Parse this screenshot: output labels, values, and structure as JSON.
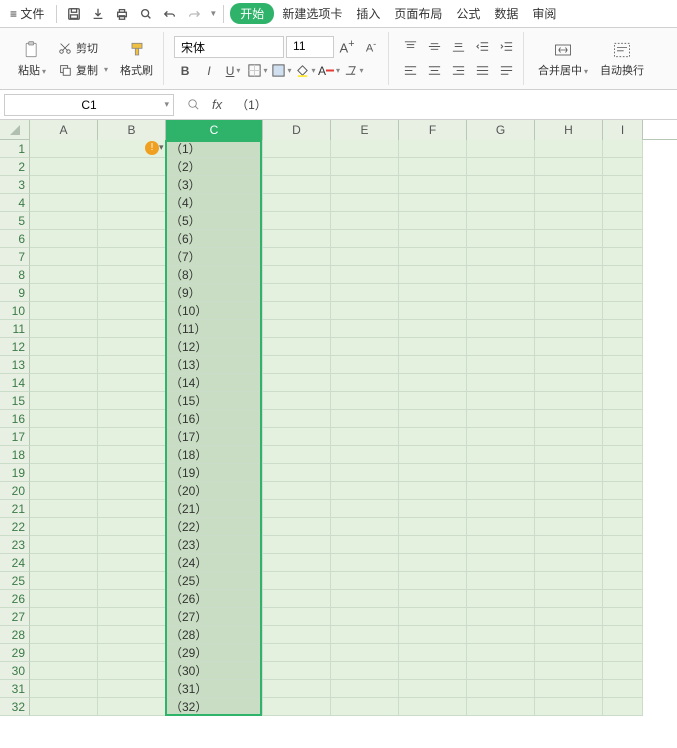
{
  "menu": {
    "file": "文件",
    "start": "开始",
    "newtab": "新建选项卡",
    "insert": "插入",
    "layout": "页面布局",
    "formula": "公式",
    "data": "数据",
    "review": "审阅"
  },
  "ribbon": {
    "paste": "粘贴",
    "cut": "剪切",
    "copy": "复制",
    "format_painter": "格式刷",
    "font_name": "宋体",
    "font_size": "11",
    "merge_center": "合并居中",
    "auto_wrap": "自动换行"
  },
  "namebox": "C1",
  "formula": "（1）",
  "columns": [
    "A",
    "B",
    "C",
    "D",
    "E",
    "F",
    "G",
    "H",
    "I"
  ],
  "row_count": 32,
  "selected_column": "C",
  "cells_C": [
    "（1）",
    "（2）",
    "（3）",
    "（4）",
    "（5）",
    "（6）",
    "（7）",
    "（8）",
    "（9）",
    "（10）",
    "（11）",
    "（12）",
    "（13）",
    "（14）",
    "（15）",
    "（16）",
    "（17）",
    "（18）",
    "（19）",
    "（20）",
    "（21）",
    "（22）",
    "（23）",
    "（24）",
    "（25）",
    "（26）",
    "（27）",
    "（28）",
    "（29）",
    "（30）",
    "（31）",
    "（32）"
  ],
  "warning_icon": "!",
  "chart_data": null
}
